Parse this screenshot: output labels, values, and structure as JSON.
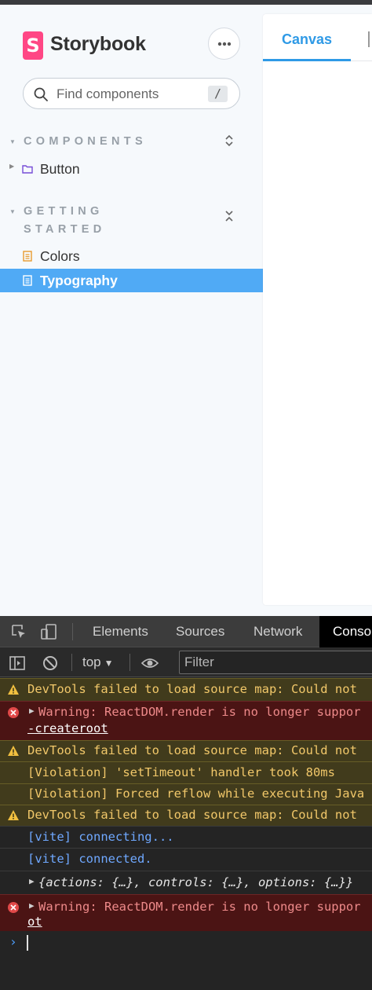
{
  "sidebar": {
    "brand": "Storybook",
    "logo_letter": "S",
    "search_placeholder": "Find components",
    "search_shortcut": "/",
    "sections": [
      {
        "title": "COMPONENTS",
        "items": [
          {
            "label": "Button",
            "icon": "folder-icon"
          }
        ]
      },
      {
        "title_line1": "GETTING",
        "title_line2": "STARTED",
        "items": [
          {
            "label": "Colors",
            "icon": "document-icon"
          },
          {
            "label": "Typography",
            "icon": "document-icon",
            "selected": true
          }
        ]
      }
    ]
  },
  "canvas": {
    "tabs": [
      {
        "label": "Canvas",
        "active": true
      }
    ]
  },
  "devtools": {
    "tabs": [
      "Elements",
      "Sources",
      "Network",
      "Conso"
    ],
    "active_tab": "Conso",
    "context": "top",
    "filter_placeholder": "Filter",
    "logs": [
      {
        "level": "warning",
        "text": "DevTools failed to load source map: Could not"
      },
      {
        "level": "error",
        "text": "Warning: ReactDOM.render is no longer suppor",
        "link": "-createroot"
      },
      {
        "level": "warning",
        "text": "DevTools failed to load source map: Could not"
      },
      {
        "level": "violation",
        "text": "[Violation] 'setTimeout' handler took 80ms"
      },
      {
        "level": "violation",
        "text": "[Violation] Forced reflow while executing Java"
      },
      {
        "level": "warning",
        "text": "DevTools failed to load source map: Could not"
      },
      {
        "level": "info",
        "text": "[vite] connecting..."
      },
      {
        "level": "info",
        "text": "[vite] connected."
      },
      {
        "level": "info",
        "text": "{actions: {…}, controls: {…}, options: {…}}"
      },
      {
        "level": "error",
        "text": "Warning: ReactDOM.render is no longer suppor",
        "link": "ot"
      }
    ],
    "prompt_symbol": "›"
  },
  "colors": {
    "accent": "#2f9ae6",
    "selected_bg": "#50aaf5",
    "brand": "#ff4785"
  }
}
